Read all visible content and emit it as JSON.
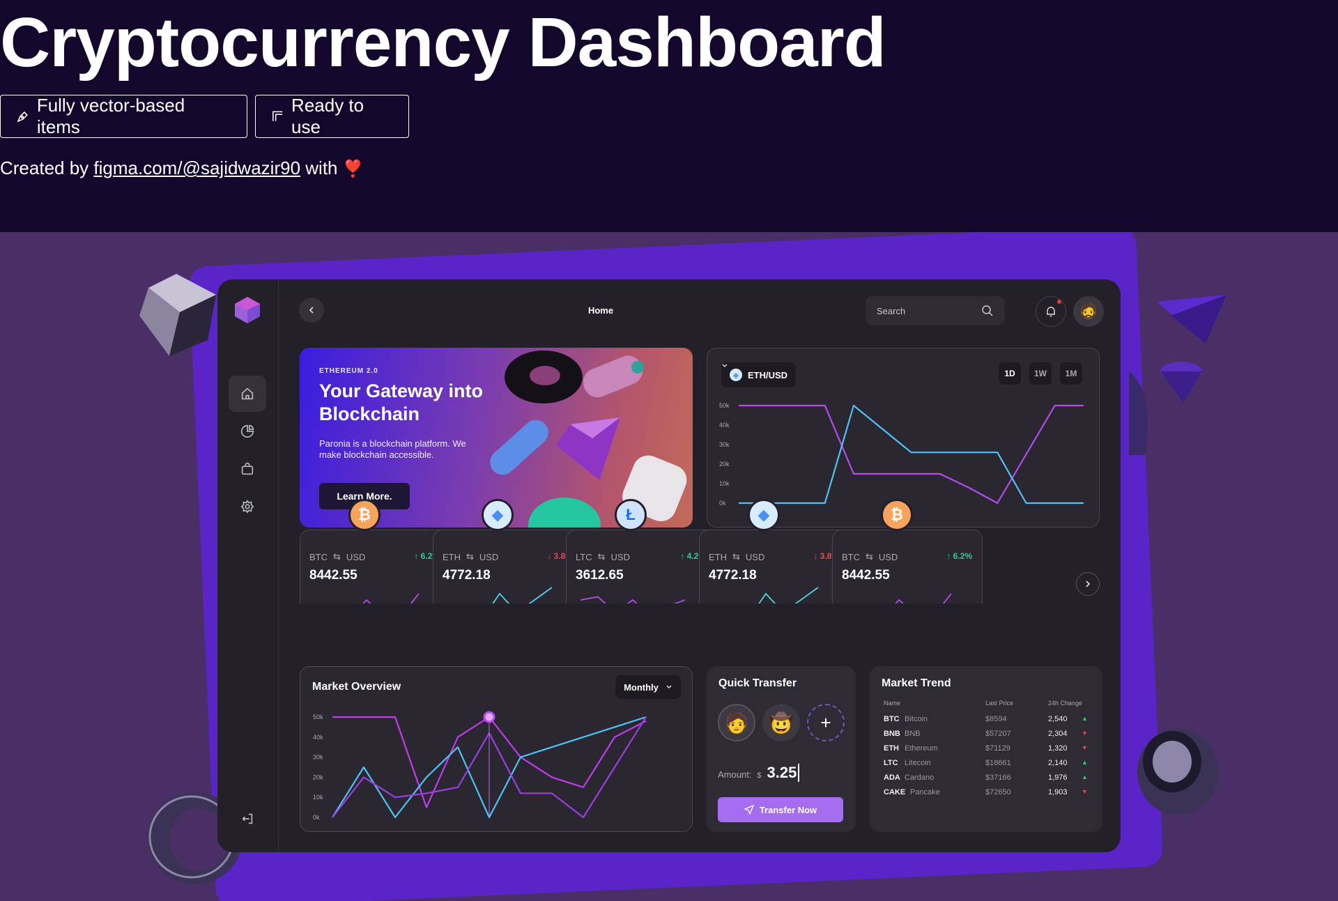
{
  "header": {
    "title": "Cryptocurrency Dashboard",
    "badges": [
      "Fully vector-based items",
      "Ready to use"
    ],
    "credit_prefix": "Created by",
    "credit_link": "figma.com/@sajidwazir90",
    "credit_suffix": "with",
    "heart": "❣️"
  },
  "topbar": {
    "title": "Home",
    "search_placeholder": "Search"
  },
  "banner": {
    "eyebrow": "ETHEREUM 2.0",
    "headline": "Your Gateway into Blockchain",
    "description": "Paronia is a blockchain platform. We make blockchain accessible.",
    "cta": "Learn More."
  },
  "price_chart": {
    "pair": "ETH/USD",
    "ranges": [
      "1D",
      "1W",
      "1M"
    ],
    "active_range": "1D"
  },
  "tickers": [
    {
      "coin": "BTC",
      "quote": "USD",
      "change": "6.2%",
      "direction": "up",
      "price": "8442.55",
      "color": "#b44cf0"
    },
    {
      "coin": "ETH",
      "quote": "USD",
      "change": "3.8%",
      "direction": "down",
      "price": "4772.18",
      "color": "#4fd6e8"
    },
    {
      "coin": "LTC",
      "quote": "USD",
      "change": "4.2%",
      "direction": "up",
      "price": "3612.65",
      "color": "#b44cf0"
    },
    {
      "coin": "ETH",
      "quote": "USD",
      "change": "3.8%",
      "direction": "down",
      "price": "4772.18",
      "color": "#4fd6e8"
    },
    {
      "coin": "BTC",
      "quote": "USD",
      "change": "6.2%",
      "direction": "up",
      "price": "8442.55",
      "color": "#b44cf0"
    }
  ],
  "market_overview": {
    "title": "Market Overview",
    "period": "Monthly"
  },
  "quick_transfer": {
    "title": "Quick Transfer",
    "amount_label": "Amount:",
    "currency": "$",
    "amount": "3.25",
    "button": "Transfer Now"
  },
  "market_trend": {
    "title": "Market Trend",
    "columns": [
      "Name",
      "Last Price",
      "24h Change"
    ],
    "rows": [
      {
        "symbol": "BTC",
        "name": "Bitcoin",
        "price": "$8594",
        "change": "2,540",
        "direction": "up"
      },
      {
        "symbol": "BNB",
        "name": "BNB",
        "price": "$57207",
        "change": "2,304",
        "direction": "down"
      },
      {
        "symbol": "ETH",
        "name": "Ethereum",
        "price": "$71129",
        "change": "1,320",
        "direction": "down"
      },
      {
        "symbol": "LTC",
        "name": "Litecoin",
        "price": "$18661",
        "change": "2,140",
        "direction": "up"
      },
      {
        "symbol": "ADA",
        "name": "Cardano",
        "price": "$37166",
        "change": "1,976",
        "direction": "up"
      },
      {
        "symbol": "CAKE",
        "name": "Pancake",
        "price": "$72650",
        "change": "1,903",
        "direction": "down"
      }
    ]
  },
  "chart_data": [
    {
      "type": "line",
      "title": "ETH/USD",
      "yticks": [
        "50k",
        "40k",
        "30k",
        "20k",
        "10k",
        "0k"
      ],
      "ylim": [
        0,
        50000
      ],
      "x": [
        0,
        1,
        2,
        3,
        4,
        5,
        6,
        7,
        8,
        9,
        10,
        11,
        12
      ],
      "series": [
        {
          "color": "#b44cf0",
          "values": [
            50000,
            50000,
            50000,
            50000,
            15000,
            15000,
            15000,
            15000,
            8000,
            0,
            25000,
            50000,
            50000
          ]
        },
        {
          "color": "#4fc3f7",
          "values": [
            0,
            0,
            0,
            0,
            52000,
            38000,
            26000,
            26000,
            26000,
            26000,
            0,
            0,
            0
          ]
        }
      ]
    },
    {
      "type": "line",
      "title": "Market Overview",
      "yticks": [
        "50k",
        "40k",
        "30k",
        "20k",
        "10k",
        "0k"
      ],
      "ylim": [
        0,
        50000
      ],
      "x": [
        0,
        1,
        2,
        3,
        4,
        5,
        6,
        7,
        8,
        9,
        10
      ],
      "series": [
        {
          "color": "#c13cf0",
          "values": [
            50000,
            50000,
            50000,
            5000,
            40000,
            50000,
            30000,
            20000,
            15000,
            40000,
            48000
          ]
        },
        {
          "color": "#4fc3f7",
          "values": [
            0,
            25000,
            0,
            20000,
            35000,
            0,
            30000,
            35000,
            40000,
            45000,
            50000
          ]
        },
        {
          "color": "#9b3ee0",
          "values": [
            0,
            20000,
            10000,
            12000,
            15000,
            42000,
            12000,
            12000,
            0,
            25000,
            50000
          ]
        }
      ]
    }
  ],
  "colors": {
    "accent": "#a66cf0",
    "panel": "#232029",
    "stage": "#4a2f67",
    "hero": "#13072c"
  }
}
